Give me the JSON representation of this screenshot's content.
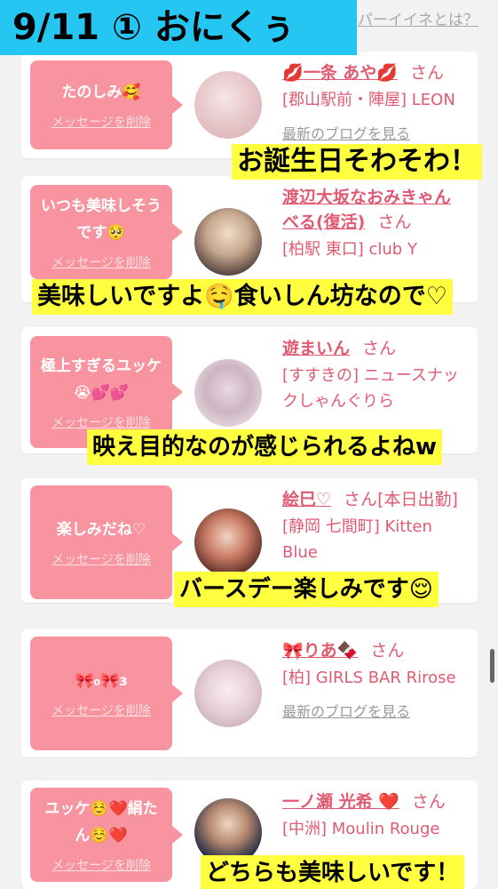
{
  "header": {
    "title": "9/11 ① おにくぅ",
    "top_link": "パーイイネとは？"
  },
  "cards": [
    {
      "message": "たのしみ🥰",
      "delete_label": "メッセージを削除",
      "name": "💋一条 あや💋",
      "honorific": "さん",
      "shop": "[郡山駅前・陣屋] LEON",
      "blog_link": "最新のブログを見る",
      "caption": "お誕生日そわそわ！"
    },
    {
      "message": "いつも美味しそうです🥺",
      "delete_label": "メッセージを削除",
      "name": "渡辺大坂なおみきゃんべる(復活)",
      "honorific": "さん",
      "shop": "[柏駅 東口] club Y",
      "blog_link": "",
      "caption": "美味しいですよ🤤食いしん坊なので♡"
    },
    {
      "message": "極上すぎるユッケ😭💕💕",
      "delete_label": "メッセージを削除",
      "name": "遊まいん",
      "honorific": "さん",
      "shop": "[すすきの] ニュースナックしゃんぐりら",
      "blog_link": "",
      "caption": "映え目的なのが感じられるよねw"
    },
    {
      "message": "楽しみだね♡",
      "delete_label": "メッセージを削除",
      "name": "絵巳♡",
      "honorific": "さん",
      "status": "[本日出勤]",
      "shop": "[静岡 七間町] Kitten Blue",
      "blog_link": "",
      "caption": "バースデー楽しみです😌"
    },
    {
      "message": "🎀₀🎀ɜ",
      "delete_label": "メッセージを削除",
      "name": "🎀りあ🍫",
      "honorific": "さん",
      "shop": "[柏] GIRLS BAR Rirose",
      "blog_link": "最新のブログを見る",
      "caption": ""
    },
    {
      "message": "ユッケ☺️❤️絹たん☺️❤️",
      "delete_label": "メッセージを削除",
      "name": "一ノ瀬 光希 ❤️",
      "honorific": "さん",
      "shop": "[中洲] Moulin Rouge",
      "blog_link": "",
      "caption": "どちらも美味しいです！"
    }
  ]
}
